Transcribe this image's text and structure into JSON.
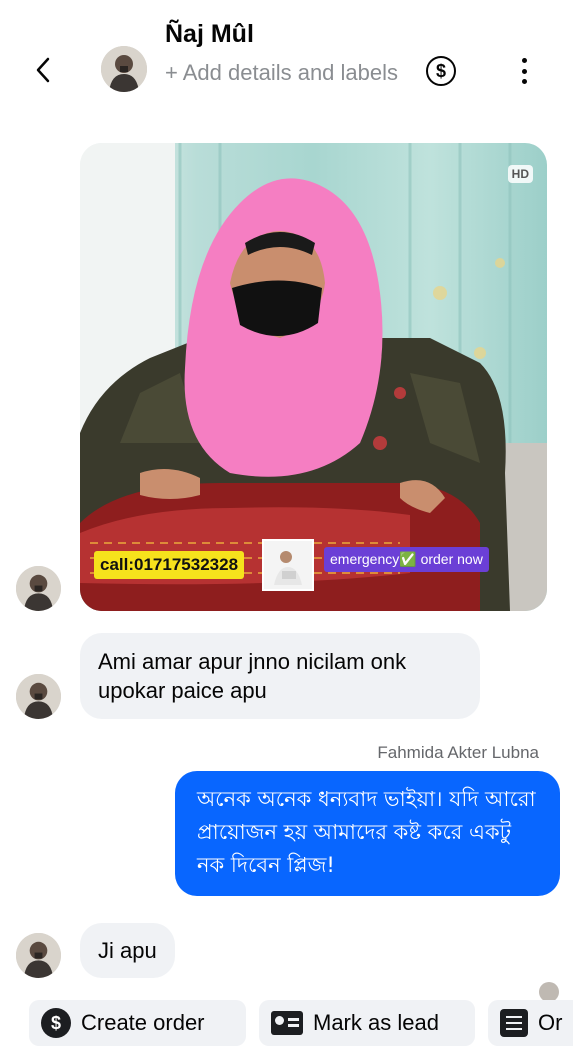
{
  "header": {
    "contact_name": "Ñaj Mûl",
    "add_details": "+ Add details and labels",
    "back_icon": "chevron-left-icon",
    "payment_icon": "dollar-circle-icon",
    "more_icon": "more-vertical-icon"
  },
  "image_message": {
    "hd_badge": "HD",
    "call_text": "call:01717532328",
    "promo_text": "emergency✅ order now"
  },
  "messages": [
    {
      "direction": "incoming",
      "text": "Ami amar apur jnno nicilam onk upokar paice apu"
    },
    {
      "direction": "outgoing",
      "sender": "Fahmida Akter Lubna",
      "text": "অনেক অনেক ধন্যবাদ ভাইয়া। যদি আরো প্রায়োজন হয় আমাদের কষ্ট করে একটু নক দিবেন প্লিজ!"
    },
    {
      "direction": "incoming",
      "text": "Ji apu"
    }
  ],
  "quick_actions": [
    {
      "label": "Create order",
      "icon": "dollar-circle-icon"
    },
    {
      "label": "Mark as lead",
      "icon": "contact-card-icon"
    },
    {
      "label": "Or",
      "icon": "list-icon"
    }
  ],
  "colors": {
    "outgoing_bubble": "#0866ff",
    "incoming_bubble": "#f0f2f5",
    "secondary_text": "#65676b"
  }
}
